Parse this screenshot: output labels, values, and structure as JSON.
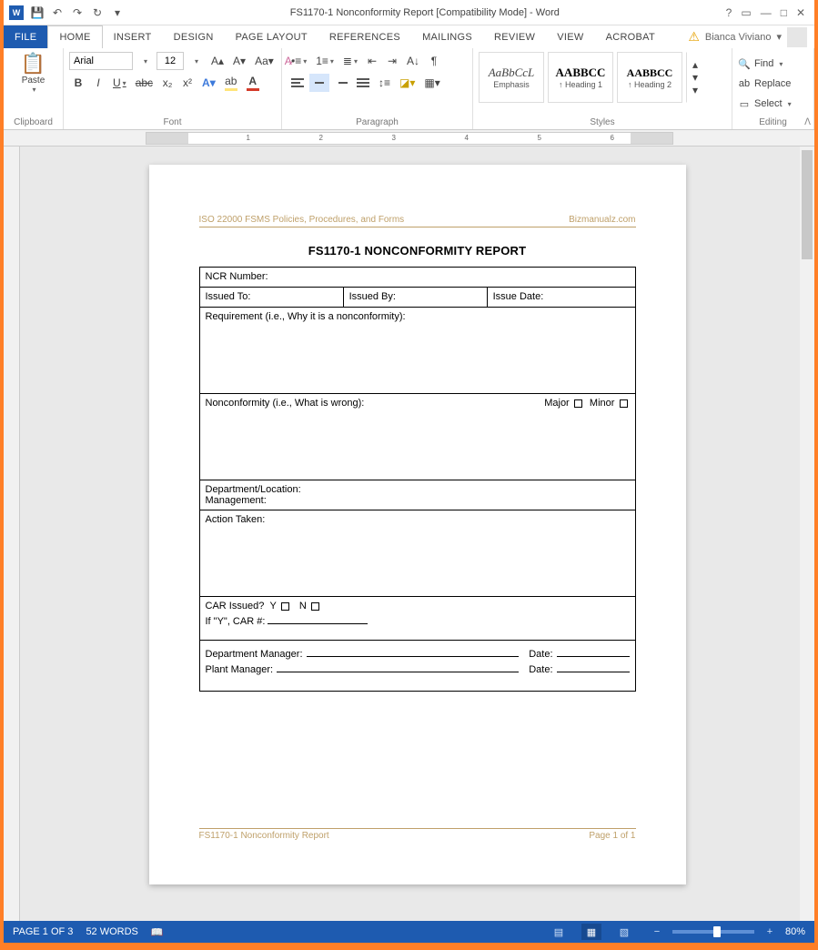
{
  "title": "FS1170-1 Nonconformity Report [Compatibility Mode] - Word",
  "user": "Bianca Viviano",
  "tabs": [
    "FILE",
    "HOME",
    "INSERT",
    "DESIGN",
    "PAGE LAYOUT",
    "REFERENCES",
    "MAILINGS",
    "REVIEW",
    "VIEW",
    "ACROBAT"
  ],
  "activeTab": "HOME",
  "clipboard": {
    "paste": "Paste",
    "label": "Clipboard"
  },
  "font": {
    "name": "Arial",
    "size": "12",
    "label": "Font"
  },
  "paragraph": {
    "label": "Paragraph"
  },
  "styles": {
    "label": "Styles",
    "items": [
      {
        "sample": "AaBbCcL",
        "name": "Emphasis",
        "cls": "em"
      },
      {
        "sample": "AABBCC",
        "name": "↑ Heading 1",
        "cls": "h1"
      },
      {
        "sample": "AABBCC",
        "name": "↑ Heading 2",
        "cls": "h2"
      }
    ]
  },
  "editing": {
    "find": "Find",
    "replace": "Replace",
    "select": "Select",
    "label": "Editing"
  },
  "doc": {
    "headerLeft": "ISO 22000 FSMS Policies, Procedures, and Forms",
    "headerRight": "Bizmanualz.com",
    "title": "FS1170-1 NONCONFORMITY REPORT",
    "ncr": "NCR Number:",
    "issuedTo": "Issued To:",
    "issuedBy": "Issued By:",
    "issueDate": "Issue Date:",
    "req": "Requirement (i.e., Why it is a nonconformity):",
    "noncon": "Nonconformity (i.e., What is wrong):",
    "major": "Major",
    "minor": "Minor",
    "deptLoc": "Department/Location:",
    "mgmt": "Management:",
    "action": "Action Taken:",
    "carIssued": "CAR Issued?",
    "y": "Y",
    "n": "N",
    "ifY": "If \"Y\", CAR #:",
    "deptMgr": "Department Manager:",
    "plantMgr": "Plant Manager:",
    "date": "Date:",
    "footerLeft": "FS1170-1 Nonconformity Report",
    "footerRight": "Page 1 of 1"
  },
  "status": {
    "page": "PAGE 1 OF 3",
    "words": "52 WORDS",
    "zoom": "80%"
  }
}
